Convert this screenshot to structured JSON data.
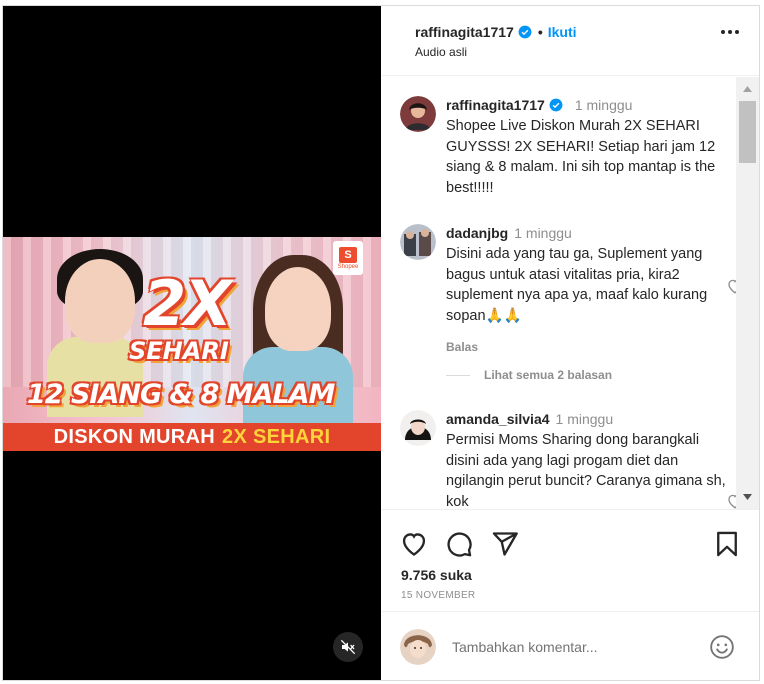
{
  "post": {
    "username": "raffinagita1717",
    "separator": "•",
    "follow_label": "Ikuti",
    "audio": "Audio asli"
  },
  "video": {
    "headline_big": "2X",
    "headline_sub": "SEHARI",
    "times": "12 SIANG  & 8 MALAM",
    "banner_text": "DISKON MURAH",
    "banner_highlight": "2X SEHARI",
    "shopee_label": "Shopee",
    "shopee_letter": "S"
  },
  "comments": [
    {
      "username": "raffinagita1717",
      "time": "1 minggu",
      "verified": true,
      "text": "Shopee Live Diskon Murah 2X SEHARI GUYSSS! 2X SEHARI! Setiap hari jam 12 siang & 8 malam. Ini sih top mantap is the best!!!!!"
    },
    {
      "username": "dadanjbg",
      "time": "1 minggu",
      "text": "Disini ada yang tau ga, Suplement yang bagus untuk atasi vitalitas pria, kira2 suplement nya apa ya, maaf kalo kurang sopan🙏🙏",
      "reply_label": "Balas",
      "view_replies": "Lihat semua 2 balasan"
    },
    {
      "username": "amanda_silvia4",
      "time": "1 minggu",
      "text": "Permisi Moms Sharing dong barangkali disini ada yang lagi progam diet dan ngilangin perut buncit? Caranya gimana sh, kok"
    }
  ],
  "stats": {
    "likes": "9.756 suka",
    "date": "15 NOVEMBER"
  },
  "composer": {
    "placeholder": "Tambahkan komentar..."
  },
  "colors": {
    "accent": "#0095f6",
    "text": "#262626",
    "muted": "#8e8e8e",
    "banner": "#e2452b"
  },
  "icons": [
    "verified-badge-icon",
    "more-options-icon",
    "heart-icon",
    "comment-icon",
    "share-icon",
    "bookmark-icon",
    "mute-icon",
    "emoji-icon",
    "scroll-up-arrow-icon",
    "scroll-down-arrow-icon"
  ]
}
